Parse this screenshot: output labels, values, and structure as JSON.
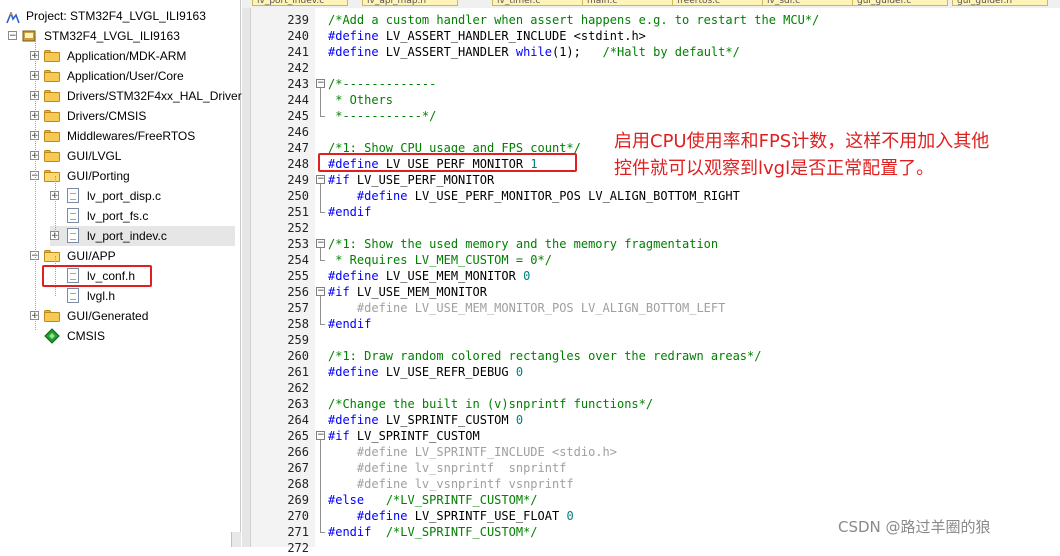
{
  "project_tree": {
    "root": "Project: STM32F4_LVGL_ILI9163",
    "target": "STM32F4_LVGL_ILI9163",
    "items": [
      {
        "label": "Application/MDK-ARM",
        "kind": "folder",
        "expander": "+"
      },
      {
        "label": "Application/User/Core",
        "kind": "folder",
        "expander": "+"
      },
      {
        "label": "Drivers/STM32F4xx_HAL_Driver",
        "kind": "folder",
        "expander": "+"
      },
      {
        "label": "Drivers/CMSIS",
        "kind": "folder",
        "expander": "+"
      },
      {
        "label": "Middlewares/FreeRTOS",
        "kind": "folder",
        "expander": "+"
      },
      {
        "label": "GUI/LVGL",
        "kind": "folder",
        "expander": "+"
      },
      {
        "label": "GUI/Porting",
        "kind": "folder-open",
        "expander": "−"
      },
      {
        "label": "lv_port_disp.c",
        "kind": "file",
        "expander": "+"
      },
      {
        "label": "lv_port_fs.c",
        "kind": "file",
        "expander": ""
      },
      {
        "label": "lv_port_indev.c",
        "kind": "file",
        "expander": "+"
      },
      {
        "label": "GUI/APP",
        "kind": "folder-open",
        "expander": "−"
      },
      {
        "label": "lv_conf.h",
        "kind": "file",
        "expander": ""
      },
      {
        "label": "lvgl.h",
        "kind": "file",
        "expander": ""
      },
      {
        "label": "GUI/Generated",
        "kind": "folder",
        "expander": "+"
      },
      {
        "label": "CMSIS",
        "kind": "cmsis-gem",
        "expander": ""
      }
    ],
    "selected": "lv_port_indev.c",
    "highlighted": "lv_conf.h"
  },
  "editor": {
    "tabs": [
      "lv_port_indev.c",
      "lv_api_map.h",
      "lv_timer.c",
      "main.c",
      "freertos.c",
      "lv_sdl.c",
      "gui_guider.c",
      "gui_guider.h"
    ],
    "lines": [
      {
        "n": "239",
        "t": "/*Add a custom handler when assert happens e.g. to restart the MCU*/",
        "c": "cm"
      },
      {
        "n": "240",
        "t": "#define LV_ASSERT_HANDLER_INCLUDE <stdint.h>",
        "c": "define"
      },
      {
        "n": "241",
        "t": "#define LV_ASSERT_HANDLER while(1);   /*Halt by default*/",
        "c": "assert"
      },
      {
        "n": "242",
        "t": "",
        "c": ""
      },
      {
        "n": "243",
        "t": "/*-------------",
        "c": "cm"
      },
      {
        "n": "244",
        "t": " * Others",
        "c": "cm"
      },
      {
        "n": "245",
        "t": " *-----------*/",
        "c": "cm"
      },
      {
        "n": "246",
        "t": "",
        "c": ""
      },
      {
        "n": "247",
        "t": "/*1: Show CPU usage and FPS count*/",
        "c": "cm"
      },
      {
        "n": "248",
        "t": "#define LV_USE_PERF_MONITOR 1",
        "c": "define"
      },
      {
        "n": "249",
        "t": "#if LV_USE_PERF_MONITOR",
        "c": "if"
      },
      {
        "n": "250",
        "t": "    #define LV_USE_PERF_MONITOR_POS LV_ALIGN_BOTTOM_RIGHT",
        "c": "define"
      },
      {
        "n": "251",
        "t": "#endif",
        "c": "pp"
      },
      {
        "n": "252",
        "t": "",
        "c": ""
      },
      {
        "n": "253",
        "t": "/*1: Show the used memory and the memory fragmentation",
        "c": "cm"
      },
      {
        "n": "254",
        "t": " * Requires LV_MEM_CUSTOM = 0*/",
        "c": "cm"
      },
      {
        "n": "255",
        "t": "#define LV_USE_MEM_MONITOR 0",
        "c": "define"
      },
      {
        "n": "256",
        "t": "#if LV_USE_MEM_MONITOR",
        "c": "if"
      },
      {
        "n": "257",
        "t": "    #define LV_USE_MEM_MONITOR_POS LV_ALIGN_BOTTOM_LEFT",
        "c": "gray"
      },
      {
        "n": "258",
        "t": "#endif",
        "c": "pp"
      },
      {
        "n": "259",
        "t": "",
        "c": ""
      },
      {
        "n": "260",
        "t": "/*1: Draw random colored rectangles over the redrawn areas*/",
        "c": "cm"
      },
      {
        "n": "261",
        "t": "#define LV_USE_REFR_DEBUG 0",
        "c": "define"
      },
      {
        "n": "262",
        "t": "",
        "c": ""
      },
      {
        "n": "263",
        "t": "/*Change the built in (v)snprintf functions*/",
        "c": "cm"
      },
      {
        "n": "264",
        "t": "#define LV_SPRINTF_CUSTOM 0",
        "c": "define"
      },
      {
        "n": "265",
        "t": "#if LV_SPRINTF_CUSTOM",
        "c": "if"
      },
      {
        "n": "266",
        "t": "    #define LV_SPRINTF_INCLUDE <stdio.h>",
        "c": "gray"
      },
      {
        "n": "267",
        "t": "    #define lv_snprintf  snprintf",
        "c": "gray"
      },
      {
        "n": "268",
        "t": "    #define lv_vsnprintf vsnprintf",
        "c": "gray"
      },
      {
        "n": "269",
        "t": "#else   /*LV_SPRINTF_CUSTOM*/",
        "c": "else"
      },
      {
        "n": "270",
        "t": "    #define LV_SPRINTF_USE_FLOAT 0",
        "c": "define"
      },
      {
        "n": "271",
        "t": "#endif  /*LV_SPRINTF_CUSTOM*/",
        "c": "else"
      },
      {
        "n": "272",
        "t": "",
        "c": ""
      }
    ]
  },
  "annotation": {
    "line1": "启用CPU使用率和FPS计数，这样不用加入其他",
    "line2": "控件就可以观察到lvgl是否正常配置了。",
    "color": "#e02020"
  },
  "watermark": "CSDN @路过羊圈的狼"
}
